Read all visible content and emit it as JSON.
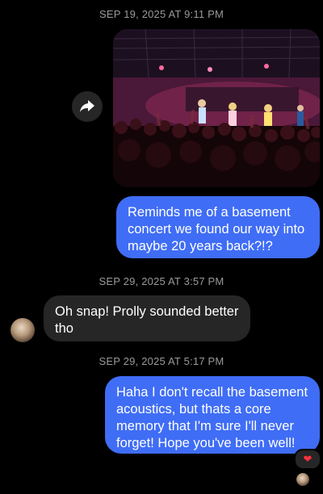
{
  "messages": {
    "timestamp_1": "SEP 19, 2025 AT 9:11 PM",
    "outgoing_1": "Reminds me of a basement concert we found our way into maybe 20 years back?!?",
    "timestamp_2": "SEP 29, 2025 AT 3:57 PM",
    "incoming_1": "Oh snap! Prolly sounded better tho",
    "timestamp_3": "SEP 29, 2025 AT 5:17 PM",
    "outgoing_2": "Haha I don't recall the basement acoustics, but thats a core memory that I'm sure I'll never forget!  Hope you've been well!"
  },
  "icons": {
    "share": "share-arrow-icon",
    "reaction": "heart-icon"
  },
  "reaction": {
    "emoji": "❤"
  },
  "colors": {
    "outgoing_bubble": "#3f6df5",
    "incoming_bubble": "#262626",
    "background": "#000000",
    "timestamp": "#9a9a9a"
  }
}
